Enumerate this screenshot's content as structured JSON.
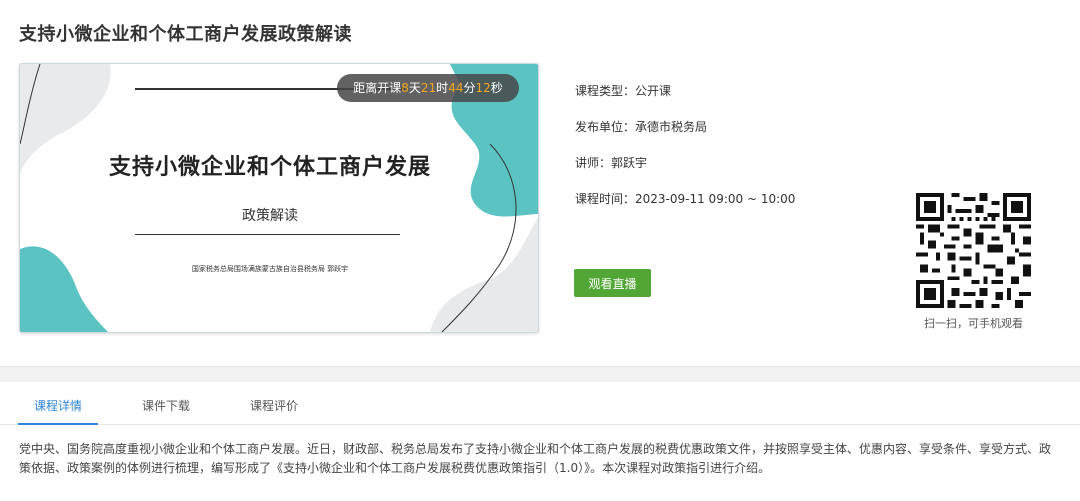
{
  "page": {
    "title": "支持小微企业和个体工商户发展政策解读"
  },
  "cover": {
    "countdown": {
      "prefix": "距离开课",
      "days": "8",
      "days_unit": "天",
      "hours": "21",
      "hours_unit": "时",
      "minutes": "44",
      "minutes_unit": "分",
      "seconds": "12",
      "seconds_unit": "秒"
    },
    "title": "支持小微企业和个体工商户发展",
    "subtitle": "政策解读",
    "author": "国家税务总局围场满族蒙古族自治县税务局  郭跃宇"
  },
  "info": {
    "type": "课程类型：公开课",
    "publisher": "发布单位：承德市税务局",
    "teacher": "讲师：郭跃宇",
    "time": "课程时间：2023-09-11 09:00 ~ 10:00"
  },
  "watch_button": "观看直播",
  "qr_caption": "扫一扫，可手机观看",
  "tabs": {
    "detail": "课程详情",
    "download": "课件下载",
    "review": "课程评价"
  },
  "description": "党中央、国务院高度重视小微企业和个体工商户发展。近日，财政部、税务总局发布了支持小微企业和个体工商户发展的税费优惠政策文件，并按照享受主体、优惠内容、享受条件、享受方式、政策依据、政策案例的体例进行梳理，编写形成了《支持小微企业和个体工商户发展税费优惠政策指引（1.0）》。本次课程对政策指引进行介绍。",
  "colors": {
    "accent": "#2f86d6",
    "button": "#52a635",
    "countdown_number": "#f5a623",
    "teal": "#5cc3c3"
  }
}
